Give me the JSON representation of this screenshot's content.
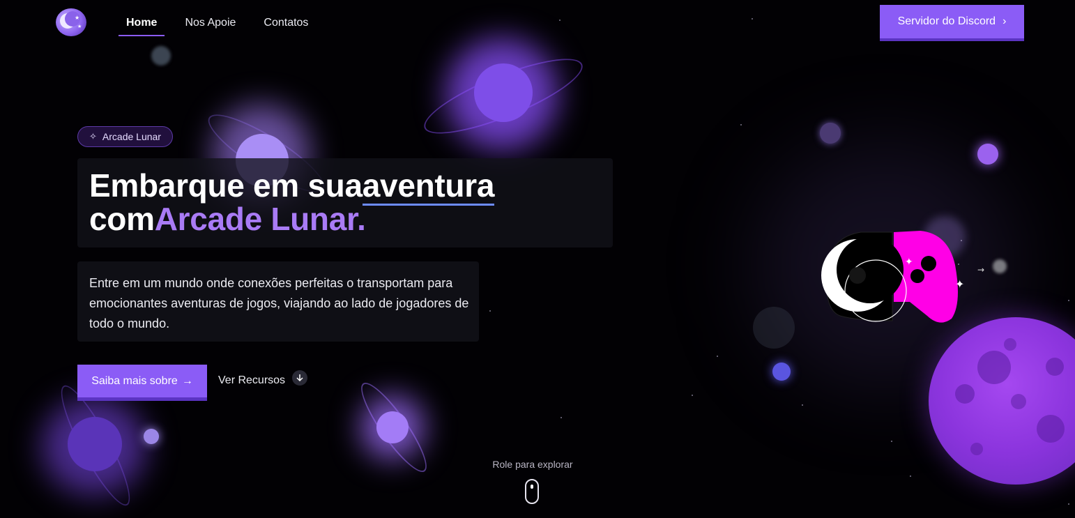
{
  "nav": {
    "items": [
      {
        "label": "Home",
        "active": true
      },
      {
        "label": "Nos Apoie",
        "active": false
      },
      {
        "label": "Contatos",
        "active": false
      }
    ],
    "cta_label": "Servidor do Discord"
  },
  "hero": {
    "badge": "Arcade Lunar",
    "title_line1_a": "Embarque em sua",
    "title_line1_b": "aventura",
    "title_line2_a": "com",
    "title_line2_b": "Arcade Lunar.",
    "description": "Entre em um mundo onde conexões perfeitas o transportam para emocionantes aventuras de jogos, viajando ao lado de jogadores de todo o mundo.",
    "primary_button": "Saiba mais sobre",
    "secondary_link": "Ver Recursos"
  },
  "scroll_hint": "Role para explorar",
  "colors": {
    "accent": "#8b5cf6",
    "accent_dark": "#5b34c2",
    "title_accent": "#a97bf5",
    "controller_pink": "#ff00e6",
    "background": "#020104"
  }
}
